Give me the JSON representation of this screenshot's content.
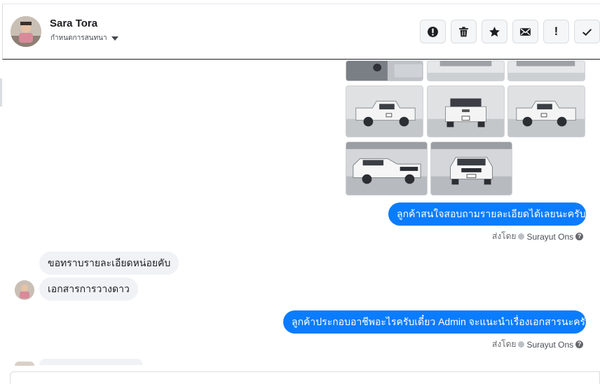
{
  "header": {
    "name": "Sara Tora",
    "subtitle": "กำหนดการสนทนา"
  },
  "actions": [
    {
      "name": "report-icon"
    },
    {
      "name": "trash-icon"
    },
    {
      "name": "star-icon"
    },
    {
      "name": "mail-icon"
    },
    {
      "name": "important-icon",
      "glyph": "!"
    },
    {
      "name": "check-icon"
    }
  ],
  "messages": {
    "out1": "ลูกค้าสนใจสอบถามรายละเอียดได้เลยนะครับ",
    "in1": "ขอทราบรายละเอียดหน่อยคับ",
    "in2": "เอกสารการวางดาว",
    "out2": "ลูกค้าประกอบอาชีพอะไรครับเดี๋ยว Admin จะแนะนำเรื่องเอกสารนะครับ"
  },
  "sent_by": {
    "prefix": "ส่งโดย",
    "agent": "Surayut Ons"
  },
  "colors": {
    "outgoing_bubble": "#0a7cff",
    "incoming_bubble": "#f0f2f5"
  }
}
